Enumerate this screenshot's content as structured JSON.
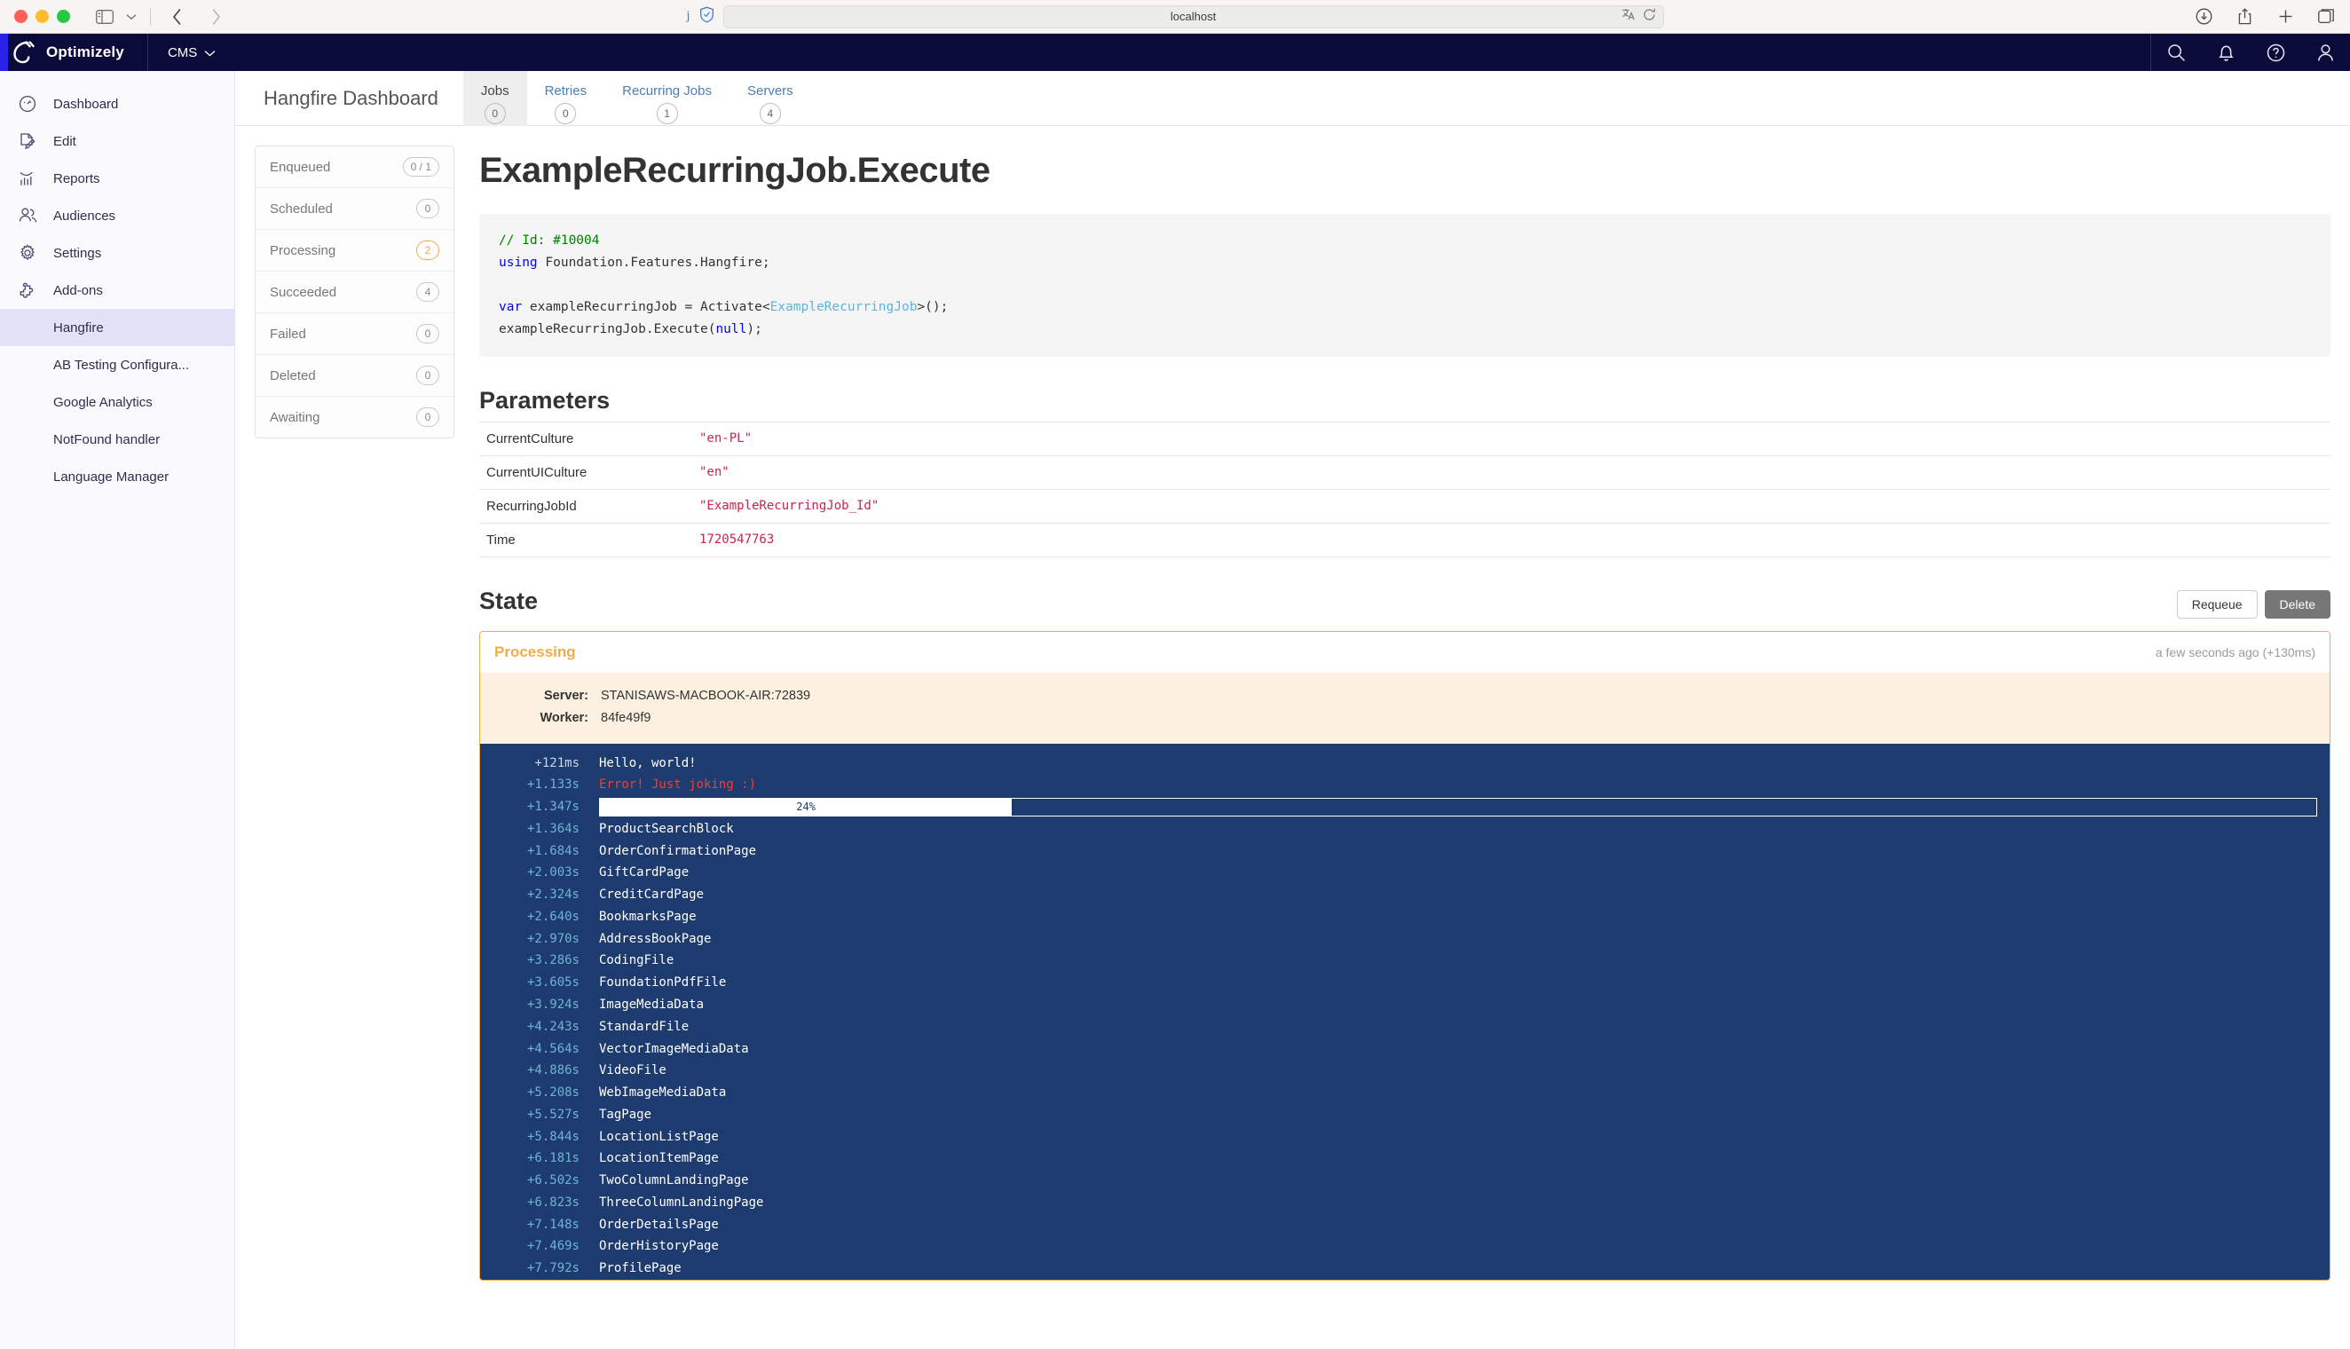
{
  "browser": {
    "url": "localhost",
    "icons": {
      "sidebar": "sidebar-toggle-icon",
      "back": "back-arrow-icon",
      "forward": "forward-arrow-icon",
      "extension_j": "j",
      "shield": "shield-extension-icon",
      "translate": "translate-icon",
      "reload": "reload-icon",
      "downloads": "downloads-icon",
      "share": "share-icon",
      "newtab": "new-tab-icon",
      "tabs": "show-tabs-icon"
    }
  },
  "topbar": {
    "brand": "Optimizely",
    "product_menu": "CMS",
    "icons": [
      "search-icon",
      "notifications-icon",
      "help-icon",
      "profile-icon"
    ],
    "bg": "#0b0b3b",
    "accent": "#2b22ea"
  },
  "cms_nav": {
    "items": [
      {
        "label": "Dashboard",
        "icon": "dashboard-icon",
        "active": false
      },
      {
        "label": "Edit",
        "icon": "edit-icon",
        "active": false
      },
      {
        "label": "Reports",
        "icon": "reports-icon",
        "active": false
      },
      {
        "label": "Audiences",
        "icon": "audiences-icon",
        "active": false
      },
      {
        "label": "Settings",
        "icon": "settings-gear-icon",
        "active": false
      },
      {
        "label": "Add-ons",
        "icon": "addons-puzzle-icon",
        "active": false
      }
    ],
    "sub_items": [
      {
        "label": "Hangfire",
        "active": true
      },
      {
        "label": "AB Testing Configura...",
        "active": false
      },
      {
        "label": "Google Analytics",
        "active": false
      },
      {
        "label": "NotFound handler",
        "active": false
      },
      {
        "label": "Language Manager",
        "active": false
      }
    ]
  },
  "hangfire": {
    "brand": "Hangfire Dashboard",
    "tabs": [
      {
        "label": "Jobs",
        "badge": "0",
        "active": true
      },
      {
        "label": "Retries",
        "badge": "0",
        "active": false
      },
      {
        "label": "Recurring Jobs",
        "badge": "1",
        "active": false
      },
      {
        "label": "Servers",
        "badge": "4",
        "active": false
      }
    ],
    "statuses": [
      {
        "label": "Enqueued",
        "count": "0 / 1",
        "warn": false
      },
      {
        "label": "Scheduled",
        "count": "0",
        "warn": false
      },
      {
        "label": "Processing",
        "count": "2",
        "warn": true
      },
      {
        "label": "Succeeded",
        "count": "4",
        "warn": false
      },
      {
        "label": "Failed",
        "count": "0",
        "warn": false
      },
      {
        "label": "Deleted",
        "count": "0",
        "warn": false
      },
      {
        "label": "Awaiting",
        "count": "0",
        "warn": false
      }
    ],
    "job_title": "ExampleRecurringJob.Execute",
    "code": {
      "comment": "// Id: #10004",
      "line_using_keyword": "using",
      "line_using_rest": " Foundation.Features.Hangfire;",
      "line_var_keyword": "var",
      "line_var_mid": " exampleRecurringJob = Activate<",
      "line_var_type": "ExampleRecurringJob",
      "line_var_tail": ">();",
      "line_exec_pre": "exampleRecurringJob.Execute(",
      "line_exec_null": "null",
      "line_exec_post": ");"
    },
    "parameters_heading": "Parameters",
    "parameters": [
      {
        "name": "CurrentCulture",
        "value": "\"en-PL\""
      },
      {
        "name": "CurrentUICulture",
        "value": "\"en\""
      },
      {
        "name": "RecurringJobId",
        "value": "\"ExampleRecurringJob_Id\""
      },
      {
        "name": "Time",
        "value": "1720547763"
      }
    ],
    "state_heading": "State",
    "requeue_label": "Requeue",
    "delete_label": "Delete",
    "state": {
      "name": "Processing",
      "time": "a few seconds ago (+130ms)",
      "server_label": "Server:",
      "server_value": "STANISAWS-MACBOOK-AIR:72839",
      "worker_label": "Worker:",
      "worker_value": "84fe49f9",
      "accent": "#f0ad4e",
      "body_bg": "#fcf1e0"
    },
    "console": {
      "bg": "#1d3b6e",
      "progress": {
        "ts": "+1.347s",
        "percent": 24,
        "label": "24%"
      },
      "lines": [
        {
          "ts": "+121ms",
          "msg": "Hello, world!",
          "error": false
        },
        {
          "ts": "+1.133s",
          "msg": "Error! Just joking :)",
          "error": true
        },
        {
          "ts": "+1.364s",
          "msg": "ProductSearchBlock",
          "error": false
        },
        {
          "ts": "+1.684s",
          "msg": "OrderConfirmationPage",
          "error": false
        },
        {
          "ts": "+2.003s",
          "msg": "GiftCardPage",
          "error": false
        },
        {
          "ts": "+2.324s",
          "msg": "CreditCardPage",
          "error": false
        },
        {
          "ts": "+2.640s",
          "msg": "BookmarksPage",
          "error": false
        },
        {
          "ts": "+2.970s",
          "msg": "AddressBookPage",
          "error": false
        },
        {
          "ts": "+3.286s",
          "msg": "CodingFile",
          "error": false
        },
        {
          "ts": "+3.605s",
          "msg": "FoundationPdfFile",
          "error": false
        },
        {
          "ts": "+3.924s",
          "msg": "ImageMediaData",
          "error": false
        },
        {
          "ts": "+4.243s",
          "msg": "StandardFile",
          "error": false
        },
        {
          "ts": "+4.564s",
          "msg": "VectorImageMediaData",
          "error": false
        },
        {
          "ts": "+4.886s",
          "msg": "VideoFile",
          "error": false
        },
        {
          "ts": "+5.208s",
          "msg": "WebImageMediaData",
          "error": false
        },
        {
          "ts": "+5.527s",
          "msg": "TagPage",
          "error": false
        },
        {
          "ts": "+5.844s",
          "msg": "LocationListPage",
          "error": false
        },
        {
          "ts": "+6.181s",
          "msg": "LocationItemPage",
          "error": false
        },
        {
          "ts": "+6.502s",
          "msg": "TwoColumnLandingPage",
          "error": false
        },
        {
          "ts": "+6.823s",
          "msg": "ThreeColumnLandingPage",
          "error": false
        },
        {
          "ts": "+7.148s",
          "msg": "OrderDetailsPage",
          "error": false
        },
        {
          "ts": "+7.469s",
          "msg": "OrderHistoryPage",
          "error": false
        },
        {
          "ts": "+7.792s",
          "msg": "ProfilePage",
          "error": false
        }
      ]
    }
  }
}
